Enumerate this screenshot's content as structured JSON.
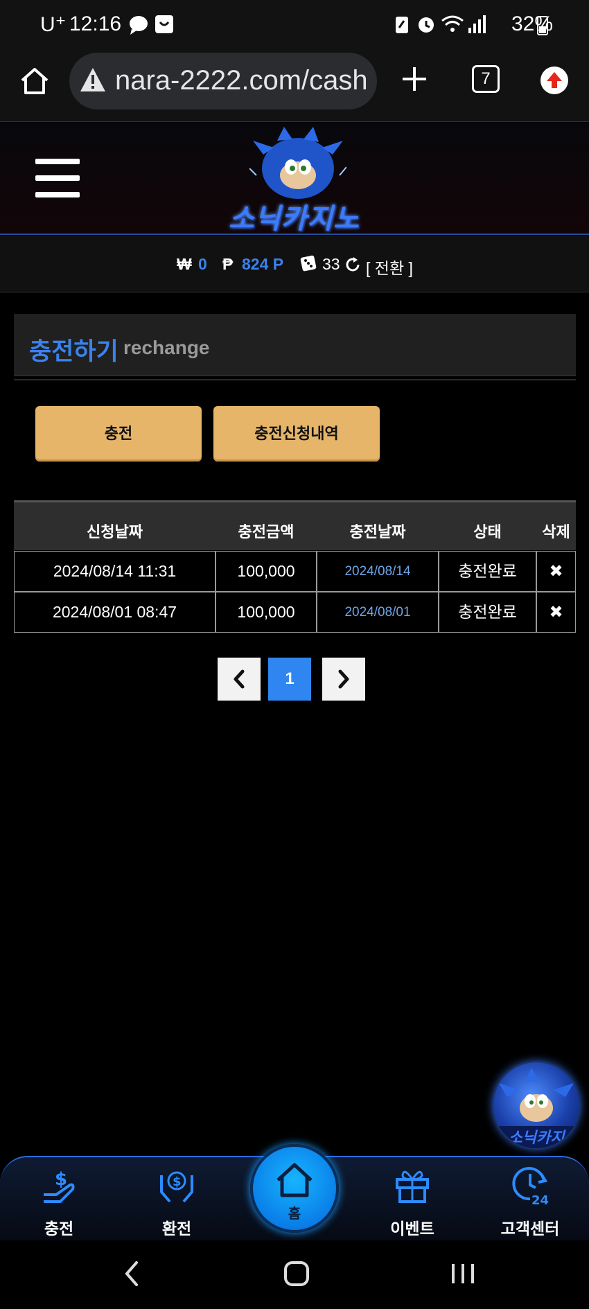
{
  "status_bar": {
    "carrier": "U⁺",
    "time": "12:16",
    "battery": "32%"
  },
  "browser": {
    "url": "nara-2222.com/cash",
    "tab_count": "7"
  },
  "site": {
    "logo_text": "소닉카지노",
    "balance": {
      "won_symbol": "₩",
      "won_value": "0",
      "point_symbol": "₱",
      "point_value": "824 P",
      "chip_value": "33",
      "switch_label": "[ 전환 ]"
    }
  },
  "page": {
    "title_ko": "충전하기",
    "title_en": "rechange",
    "buttons": {
      "charge": "충전",
      "history": "충전신청내역"
    }
  },
  "table": {
    "headers": [
      "신청날짜",
      "충전금액",
      "충전날짜",
      "상태",
      "삭제"
    ],
    "rows": [
      {
        "request_date": "2024/08/14 11:31",
        "amount": "100,000",
        "charge_date": "2024/08/14",
        "status": "충전완료",
        "delete": "✖"
      },
      {
        "request_date": "2024/08/01 08:47",
        "amount": "100,000",
        "charge_date": "2024/08/01",
        "status": "충전완료",
        "delete": "✖"
      }
    ]
  },
  "pagination": {
    "current": "1"
  },
  "bottom_nav": {
    "charge": "충전",
    "exchange": "환전",
    "home": "홈",
    "event": "이벤트",
    "support": "고객센터"
  },
  "colors": {
    "accent_blue": "#3b82ec",
    "button_gold": "#e6b56a",
    "page_active": "#2f86f0"
  },
  "icons": [
    "home-icon",
    "warning-icon",
    "plus-icon",
    "tabs-icon",
    "upload-icon",
    "menu-icon",
    "refresh-icon",
    "chevron-left-icon",
    "chevron-right-icon",
    "charge-icon",
    "exchange-icon",
    "gift-icon",
    "support-24-icon",
    "back-icon",
    "home-circle-icon",
    "recents-icon"
  ]
}
